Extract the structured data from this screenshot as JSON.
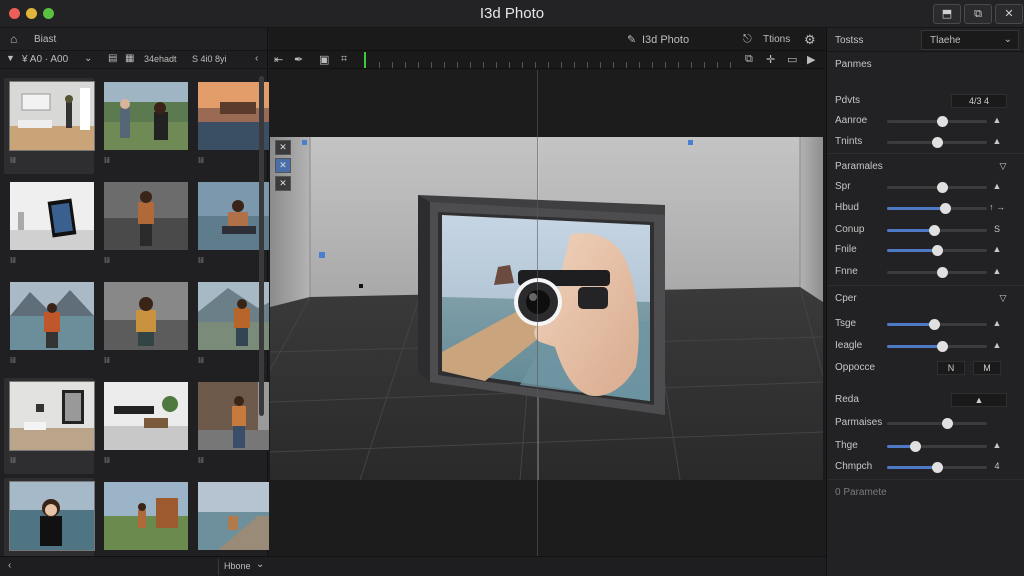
{
  "app": {
    "title": "I3d Photo"
  },
  "window_controls": [
    {
      "name": "minimize-window-button",
      "glyph": "⬒"
    },
    {
      "name": "restore-window-button",
      "glyph": "⧉"
    },
    {
      "name": "close-window-button",
      "glyph": "✕"
    }
  ],
  "left_panel": {
    "header_label": "Biast",
    "filter_label": "¥ A0 · A00",
    "path_label": "34ehadt",
    "zoom_label": "S 4i0 8yi",
    "thumbnails": [
      {
        "label": "Iil",
        "scene": "room",
        "selected": true
      },
      {
        "label": "Iil",
        "scene": "people",
        "selected": false
      },
      {
        "label": "Iil",
        "scene": "sunset",
        "selected": false
      },
      {
        "label": "Iil",
        "scene": "gallery",
        "selected": false
      },
      {
        "label": "Iil",
        "scene": "woman-pavement",
        "selected": false
      },
      {
        "label": "Iil",
        "scene": "woman-sitting",
        "selected": false
      },
      {
        "label": "Iil",
        "scene": "woman-lake",
        "selected": false
      },
      {
        "label": "Iil",
        "scene": "woman-rocks",
        "selected": false
      },
      {
        "label": "Iil",
        "scene": "woman-mountain",
        "selected": false
      },
      {
        "label": "Iil",
        "scene": "living-room",
        "selected": true
      },
      {
        "label": "Iil",
        "scene": "sofa",
        "selected": false
      },
      {
        "label": "Iil",
        "scene": "woman-wall",
        "selected": false
      },
      {
        "label": "Iil",
        "scene": "woman-sea",
        "selected": true
      },
      {
        "label": "Iil",
        "scene": "field-box",
        "selected": false
      },
      {
        "label": "Iil",
        "scene": "shore",
        "selected": false
      }
    ]
  },
  "center_panel": {
    "view_label": "I3d Photo",
    "tools_label": "Ttions",
    "status_label": "Hbone"
  },
  "right_panel": {
    "header_left": "Tostss",
    "dropdown_value": "Tlaehe",
    "title": "Panmes",
    "rows": [
      {
        "label": "Pdvts",
        "type": "box",
        "value": "4/3 4"
      },
      {
        "label": "Aanroe",
        "type": "slider",
        "fraction": 0.55,
        "filled": false,
        "value": "▲"
      },
      {
        "label": "Tnints",
        "type": "slider",
        "fraction": 0.5,
        "filled": false,
        "value": "▲"
      },
      {
        "label": "Paramales",
        "type": "section",
        "value": "▽"
      },
      {
        "label": "Spr",
        "type": "slider",
        "fraction": 0.55,
        "filled": false,
        "value": "▲"
      },
      {
        "label": "Hbud",
        "type": "slider",
        "fraction": 0.58,
        "filled": true,
        "value": "↑ →"
      },
      {
        "label": "Conup",
        "type": "slider",
        "fraction": 0.47,
        "filled": true,
        "value": "S"
      },
      {
        "label": "Fnile",
        "type": "slider",
        "fraction": 0.5,
        "filled": true,
        "value": "▲"
      },
      {
        "label": "Fnne",
        "type": "slider",
        "fraction": 0.55,
        "filled": false,
        "value": "▲"
      },
      {
        "label": "Cper",
        "type": "section",
        "value": "▽"
      },
      {
        "label": "Tsge",
        "type": "slider",
        "fraction": 0.47,
        "filled": true,
        "value": "▲"
      },
      {
        "label": "Ieagle",
        "type": "slider",
        "fraction": 0.55,
        "filled": true,
        "value": "▲"
      },
      {
        "label": "Oppocce",
        "type": "buttons",
        "value": "N",
        "value2": "M"
      },
      {
        "label": "Reda",
        "type": "box",
        "value": "▲"
      },
      {
        "label": "Parmaises",
        "type": "slider",
        "fraction": 0.6,
        "filled": false,
        "value": ""
      },
      {
        "label": "Thge",
        "type": "slider",
        "fraction": 0.28,
        "filled": true,
        "value": "▲"
      },
      {
        "label": "Chmpch",
        "type": "slider",
        "fraction": 0.5,
        "filled": true,
        "value": "4"
      },
      {
        "label": "0 Paramete",
        "type": "footer",
        "value": ""
      }
    ]
  }
}
